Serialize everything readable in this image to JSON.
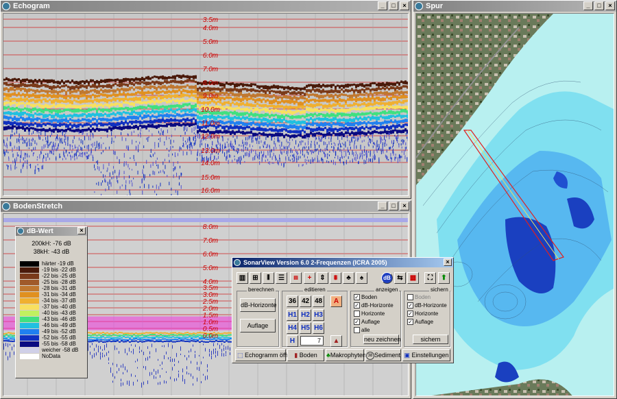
{
  "echogram": {
    "title": "Echogram",
    "depth_labels": [
      "3.5m",
      "4.0m",
      "5.0m",
      "6.0m",
      "7.0m",
      "8.0m",
      "9.0m",
      "10.0m",
      "11.0m",
      "12.0m",
      "13.0m",
      "14.0m",
      "15.0m",
      "16.0m"
    ]
  },
  "bodenstretch": {
    "title": "BodenStretch",
    "depth_labels": [
      "8.0m",
      "7.0m",
      "6.0m",
      "5.0m",
      "4.0m",
      "3.5m",
      "3.0m",
      "2.5m",
      "2.0m",
      "1.5m",
      "1.0m",
      "0.5m",
      "0.0m"
    ]
  },
  "spur": {
    "title": "Spur"
  },
  "dbwert": {
    "title": "dB-Wert",
    "line1": "200kH: -76 dB",
    "line2": "38kH: -43 dB",
    "legend": [
      {
        "label": "härter -19 dB",
        "color": "#000000"
      },
      {
        "label": "-19 bis -22 dB",
        "color": "#4a1a0a"
      },
      {
        "label": "-22 bis -25 dB",
        "color": "#7a3a1a"
      },
      {
        "label": "-25 bis -28 dB",
        "color": "#a05a2a"
      },
      {
        "label": "-28 bis -31 dB",
        "color": "#c07830"
      },
      {
        "label": "-31 bis -34 dB",
        "color": "#e09020"
      },
      {
        "label": "-34 bis -37 dB",
        "color": "#f0b030"
      },
      {
        "label": "-37 bis -40 dB",
        "color": "#f8e060"
      },
      {
        "label": "-40 bis -43 dB",
        "color": "#c0f060"
      },
      {
        "label": "-43 bis -46 dB",
        "color": "#40e080"
      },
      {
        "label": "-46 bis -49 dB",
        "color": "#20c0e0"
      },
      {
        "label": "-49 bis -52 dB",
        "color": "#2080f0"
      },
      {
        "label": "-52 bis -55 dB",
        "color": "#1030c0"
      },
      {
        "label": "-55 bis -58 dB",
        "color": "#0a0a80"
      },
      {
        "label": "weicher -58 dB",
        "color": "#d0d0e8"
      },
      {
        "label": "NoData",
        "color": "#ffffff"
      }
    ]
  },
  "sonar": {
    "title": "SonarView Version 6.0  2-Frequenzen  (ICRA 2005)",
    "groups": {
      "berechnen": "berechnen",
      "editieren": "editieren",
      "anzeigen": "anzeigen",
      "sichern": "sichern"
    },
    "calc_buttons": [
      "dB-Horizonte",
      "Auflage"
    ],
    "num_buttons": [
      "36",
      "42",
      "48"
    ],
    "h_buttons": [
      "H1",
      "H2",
      "H3",
      "H4",
      "H5",
      "H6"
    ],
    "h_label": "H",
    "edit_value": "7",
    "anzeigen_items": [
      {
        "label": "Boden",
        "checked": true
      },
      {
        "label": "dB-Horizonte",
        "checked": true
      },
      {
        "label": "Horizonte",
        "checked": false
      },
      {
        "label": "Auflage",
        "checked": true
      },
      {
        "label": "alle",
        "checked": false
      }
    ],
    "sichern_items": [
      {
        "label": "Boden",
        "checked": false
      },
      {
        "label": "dB-Horizonte",
        "checked": true
      },
      {
        "label": "Horizonte",
        "checked": true
      },
      {
        "label": "Auflage",
        "checked": true
      }
    ],
    "neu_zeichnen": "neu zeichnen",
    "sichern_btn": "sichern",
    "a_label": "A",
    "db_label": "dB",
    "bottom_buttons": [
      "Echogramm öffnen",
      "Boden",
      "Makrophyten",
      "Sediment",
      "Einstellungen"
    ]
  }
}
